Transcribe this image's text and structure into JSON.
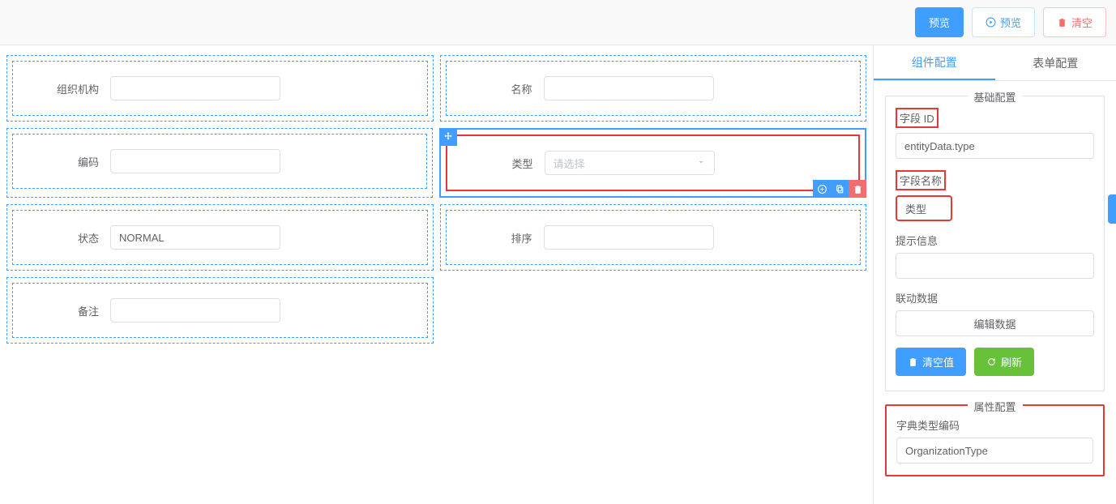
{
  "toolbar": {
    "preview_solid": "预览",
    "preview_outline": "预览",
    "clear": "清空"
  },
  "form": {
    "rows": [
      [
        {
          "label": "组织机构",
          "value": "",
          "placeholder": "",
          "type": "input",
          "name": "org-field"
        },
        {
          "label": "名称",
          "value": "",
          "placeholder": "",
          "type": "input",
          "name": "name-field"
        }
      ],
      [
        {
          "label": "编码",
          "value": "",
          "placeholder": "",
          "type": "input",
          "name": "code-field"
        },
        {
          "label": "类型",
          "value": "",
          "placeholder": "请选择",
          "type": "select",
          "name": "type-field",
          "selected": true,
          "annot": true
        }
      ],
      [
        {
          "label": "状态",
          "value": "NORMAL",
          "placeholder": "",
          "type": "input",
          "name": "status-field"
        },
        {
          "label": "排序",
          "value": "",
          "placeholder": "",
          "type": "input",
          "name": "sort-field"
        }
      ],
      [
        {
          "label": "备注",
          "value": "",
          "placeholder": "",
          "type": "input",
          "name": "remark-field",
          "fullrow": true
        }
      ]
    ]
  },
  "panel": {
    "tabs": {
      "component": "组件配置",
      "form": "表单配置"
    },
    "basic_section": "基础配置",
    "field_id_label": "字段 ID",
    "field_id_value": "entityData.type",
    "field_name_label": "字段名称",
    "field_name_value": "类型",
    "tip_label": "提示信息",
    "tip_value": "",
    "linkage_label": "联动数据",
    "linkage_btn": "编辑数据",
    "clear_value_btn": "清空值",
    "refresh_btn": "刷新",
    "attr_section": "属性配置",
    "dict_label": "字典类型编码",
    "dict_value": "OrganizationType"
  }
}
